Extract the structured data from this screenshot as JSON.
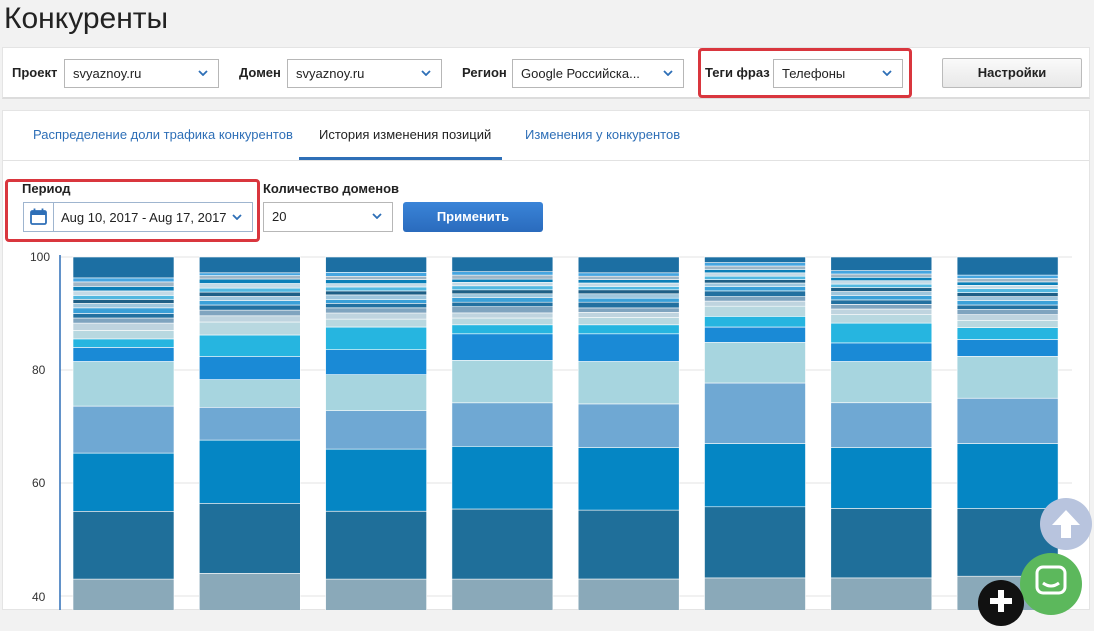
{
  "page": {
    "title": "Конкуренты"
  },
  "filters": {
    "project_label": "Проект",
    "project_value": "svyaznoy.ru",
    "domain_label": "Домен",
    "domain_value": "svyaznoy.ru",
    "region_label": "Регион",
    "region_value": "Google Российска...",
    "tags_label": "Теги фраз",
    "tags_value": "Телефоны",
    "settings_button": "Настройки"
  },
  "tabs": [
    {
      "label": "Распределение доли трафика конкурентов",
      "active": false
    },
    {
      "label": "История изменения позиций",
      "active": true
    },
    {
      "label": "Изменения у конкурентов",
      "active": false
    }
  ],
  "controls": {
    "period_label": "Период",
    "period_value": "Aug 10, 2017 - Aug 17, 2017",
    "domains_label": "Количество доменов",
    "domains_value": "20",
    "apply_button": "Применить"
  },
  "colors": {
    "highlight": "#d9363e",
    "accent": "#2e6fb7",
    "chat_button": "#5cb85c",
    "scroll_top_button": "#b8c4de"
  },
  "icons": [
    "calendar-icon",
    "chevron-down-icon",
    "arrow-up-icon",
    "chat-icon",
    "plus-icon"
  ],
  "chart_data": {
    "type": "bar",
    "stacked": true,
    "y_ticks": [
      "100",
      "80",
      "60",
      "40"
    ],
    "visible_ylim": [
      38,
      100
    ],
    "bar_count": 8,
    "segment_palette": [
      "#8aa9b9",
      "#1f6f9a",
      "#0586c4",
      "#6fa8d3",
      "#a7d5df",
      "#1a8ad6",
      "#26b5e0",
      "#b8d8e0",
      "#bfd4df",
      "#7fa4bf",
      "#2270a0",
      "#3aa0d8",
      "#9ec6dd",
      "#1e5f86",
      "#52b8e0",
      "#c4dae6",
      "#0a7fb8",
      "#9fb6c6",
      "#45a5e0",
      "#1c6fa3"
    ],
    "bars": [
      [
        43,
        55,
        65.3,
        73.6,
        81.5,
        84,
        85.5,
        87,
        88.3,
        89.2,
        90,
        91,
        91.8,
        92.5,
        93.2,
        94,
        94.8,
        95.6,
        96.3,
        100
      ],
      [
        44,
        56.4,
        67.6,
        73.4,
        78.3,
        82.4,
        86.2,
        88.5,
        89.6,
        90.6,
        91.5,
        92.3,
        93,
        93.8,
        94.5,
        95.3,
        96.1,
        96.7,
        97.2,
        100
      ],
      [
        43,
        55,
        66,
        72.8,
        79.2,
        83.6,
        87.6,
        89,
        90.1,
        91,
        91.8,
        92.5,
        93.3,
        94,
        94.7,
        95.3,
        96,
        96.6,
        97.3,
        100
      ],
      [
        43,
        55.4,
        66.5,
        74.2,
        81.7,
        86.4,
        88,
        89.2,
        90.1,
        91.2,
        92,
        92.8,
        93.5,
        94.2,
        94.9,
        95.5,
        96.1,
        96.8,
        97.4,
        100
      ],
      [
        43,
        55.2,
        66.3,
        74,
        81.5,
        86.4,
        88,
        89.3,
        90.2,
        91,
        92,
        92.7,
        93.5,
        94.2,
        94.8,
        95.4,
        96,
        96.6,
        97.2,
        100
      ],
      [
        43.2,
        55.8,
        67,
        77.7,
        84.9,
        87.6,
        89.5,
        91.3,
        92.2,
        93,
        94,
        94.8,
        95.4,
        96,
        96.6,
        97.2,
        97.8,
        98.4,
        99,
        100
      ],
      [
        43.2,
        55.5,
        66.3,
        74.2,
        81.5,
        84.8,
        88.3,
        89.8,
        90.8,
        91.6,
        92.4,
        93.2,
        93.9,
        94.6,
        95.2,
        95.8,
        96.4,
        97,
        97.6,
        100
      ],
      [
        43.5,
        55.5,
        67,
        75,
        82.4,
        85.4,
        87.5,
        88.8,
        89.8,
        90.7,
        91.5,
        92.3,
        93,
        93.7,
        94.4,
        95,
        95.6,
        96.2,
        96.8,
        100
      ]
    ]
  }
}
